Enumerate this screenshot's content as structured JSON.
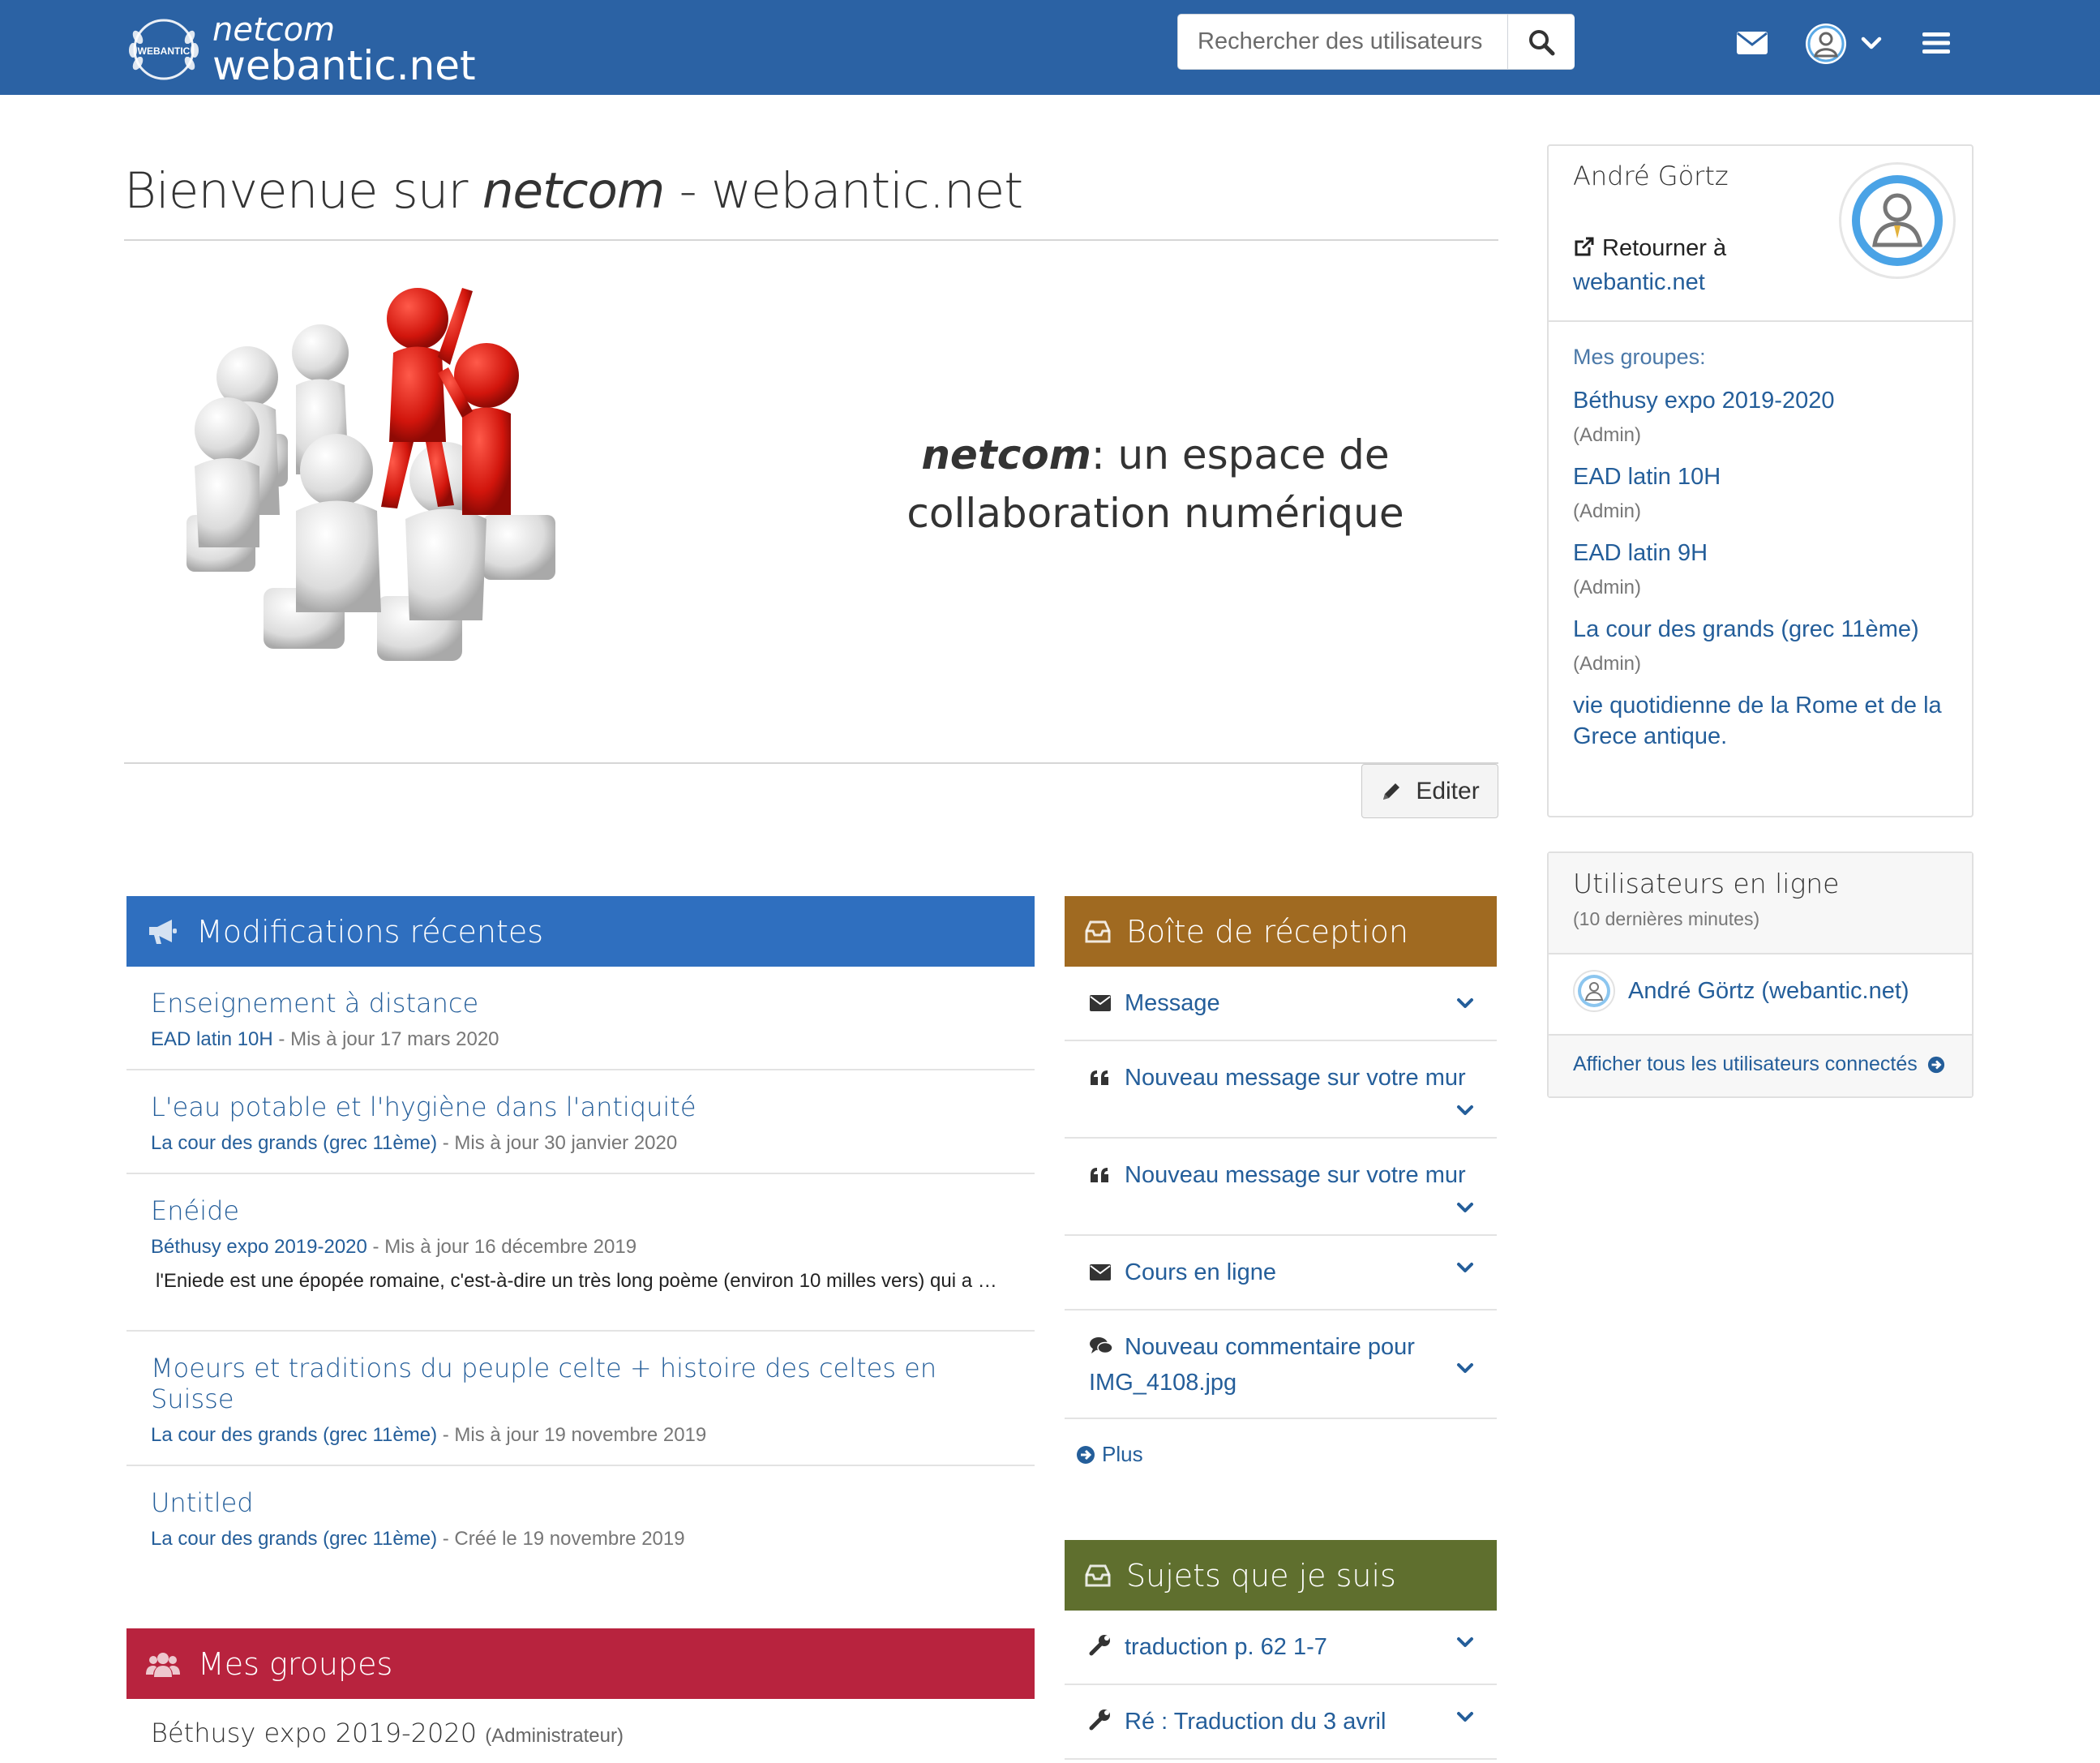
{
  "header": {
    "logo_top": "netcom",
    "logo_bottom": "webantic.net",
    "logo_emblem_text": "WEBANTIC",
    "search_placeholder": "Rechercher des utilisateurs",
    "icons": [
      "envelope-icon",
      "user-icon",
      "chevron-down-icon",
      "hamburger-icon"
    ],
    "color": "#2b62a4"
  },
  "main": {
    "title_prefix": "Bienvenue sur ",
    "title_em": "netcom",
    "title_suffix": " - webantic.net",
    "tagline_em": "netcom",
    "tagline_rest": ": un espace de collaboration numérique",
    "edit_label": "Editer"
  },
  "recent": {
    "title": "Modifications récentes",
    "color": "#2f6fbf",
    "items": [
      {
        "title": "Enseignement à distance",
        "group": "EAD latin 10H",
        "meta": " - Mis à jour 17 mars 2020",
        "desc": ""
      },
      {
        "title": "L'eau potable et l'hygiène dans l'antiquité",
        "group": "La cour des grands (grec 11ème)",
        "meta": " - Mis à jour 30 janvier 2020",
        "desc": ""
      },
      {
        "title": "Enéide",
        "group": "Béthusy expo 2019-2020",
        "meta": " - Mis à jour 16 décembre 2019",
        "desc": "l'Eniede est une épopée romaine, c'est-à-dire un très long poème (environ 10 milles vers) qui a …"
      },
      {
        "title": "Moeurs et traditions du peuple celte + histoire des celtes en Suisse",
        "group": "La cour des grands (grec 11ème)",
        "meta": " - Mis à jour 19 novembre 2019",
        "desc": ""
      },
      {
        "title": "Untitled",
        "group": "La cour des grands (grec 11ème)",
        "meta": " - Créé le 19 novembre 2019",
        "desc": ""
      }
    ]
  },
  "inbox": {
    "title": "Boîte de réception",
    "color": "#a06a21",
    "items": [
      {
        "icon": "envelope-icon",
        "label": "Message"
      },
      {
        "icon": "quote-icon",
        "label": "Nouveau message sur votre mur"
      },
      {
        "icon": "quote-icon",
        "label": "Nouveau message sur votre mur"
      },
      {
        "icon": "envelope-icon",
        "label": "Cours en ligne"
      },
      {
        "icon": "comments-icon",
        "label": "Nouveau commentaire pour IMG_4108.jpg"
      }
    ],
    "more": "Plus"
  },
  "topics": {
    "title": "Sujets que je suis",
    "color": "#5f6f2e",
    "items": [
      {
        "icon": "wrench-icon",
        "label": "traduction p. 62 1-7"
      },
      {
        "icon": "wrench-icon",
        "label": "Ré : Traduction du 3 avril"
      }
    ]
  },
  "groups_panel": {
    "title": "Mes groupes",
    "color": "#b8233e",
    "first_group": "Béthusy expo 2019-2020",
    "first_role": "(Administrateur)"
  },
  "sidebar": {
    "user_name": "André Görtz",
    "back_text": "Retourner à ",
    "back_link": "webantic.net",
    "groups_label": "Mes groupes:",
    "groups": [
      {
        "name": "Béthusy expo 2019-2020",
        "role": "(Admin)"
      },
      {
        "name": "EAD latin 10H",
        "role": "(Admin)"
      },
      {
        "name": "EAD latin 9H",
        "role": "(Admin)"
      },
      {
        "name": "La cour des grands (grec 11ème)",
        "role": "(Admin)"
      },
      {
        "name": "vie quotidienne de la Rome et de la Grece antique.",
        "role": ""
      }
    ],
    "online_title": "Utilisateurs en ligne",
    "online_sub": "(10 dernières minutes)",
    "online_user": "André Görtz (webantic.net)",
    "online_all": "Afficher tous les utilisateurs connectés"
  }
}
